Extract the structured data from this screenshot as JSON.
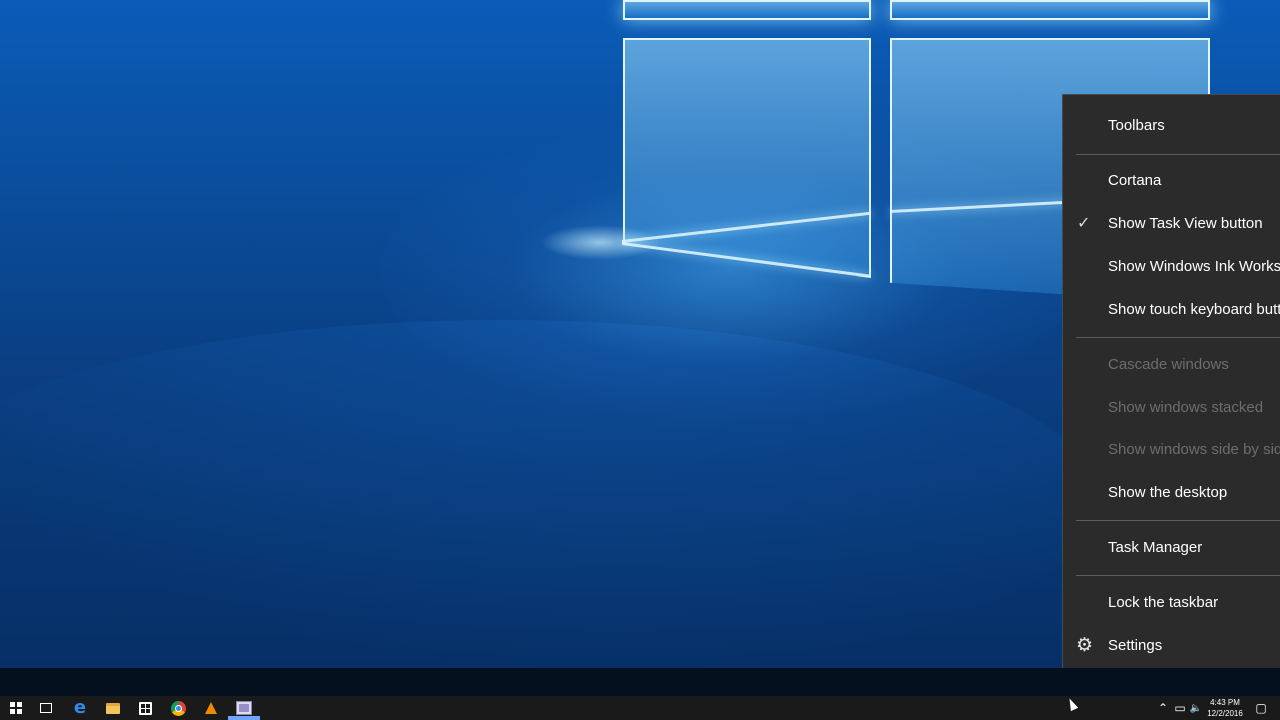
{
  "desktop": {
    "wallpaper": "Windows 10 hero"
  },
  "context_menu": {
    "items": [
      {
        "label": "Toolbars",
        "state": "normal"
      },
      {
        "label": "Cortana",
        "state": "normal"
      },
      {
        "label": "Show Task View button",
        "state": "checked"
      },
      {
        "label": "Show Windows Ink Workspace button",
        "state": "normal"
      },
      {
        "label": "Show touch keyboard button",
        "state": "normal"
      },
      {
        "label": "Cascade windows",
        "state": "disabled"
      },
      {
        "label": "Show windows stacked",
        "state": "disabled"
      },
      {
        "label": "Show windows side by side",
        "state": "disabled"
      },
      {
        "label": "Show the desktop",
        "state": "normal"
      },
      {
        "label": "Task Manager",
        "state": "normal"
      },
      {
        "label": "Lock the taskbar",
        "state": "normal"
      },
      {
        "label": "Settings",
        "state": "normal",
        "icon": "gear-icon"
      }
    ],
    "check_glyph": "✓",
    "gear_glyph": "⚙"
  },
  "taskbar": {
    "pinned": [
      {
        "name": "start-button",
        "icon": "windows-logo-icon"
      },
      {
        "name": "task-view-button",
        "icon": "task-view-icon"
      },
      {
        "name": "edge-button",
        "icon": "edge-icon",
        "glyph": "e"
      },
      {
        "name": "file-explorer-button",
        "icon": "folder-icon"
      },
      {
        "name": "store-button",
        "icon": "store-icon"
      },
      {
        "name": "chrome-button",
        "icon": "chrome-icon"
      },
      {
        "name": "vlc-button",
        "icon": "vlc-icon"
      },
      {
        "name": "app-button",
        "icon": "app-window-icon",
        "active": true
      }
    ],
    "tray": {
      "chevron_glyph": "⌃",
      "network_glyph": "▭",
      "volume_glyph": "🔈",
      "notification_glyph": "▢"
    },
    "clock": {
      "time": "4:43 PM",
      "date": "12/2/2016"
    }
  }
}
